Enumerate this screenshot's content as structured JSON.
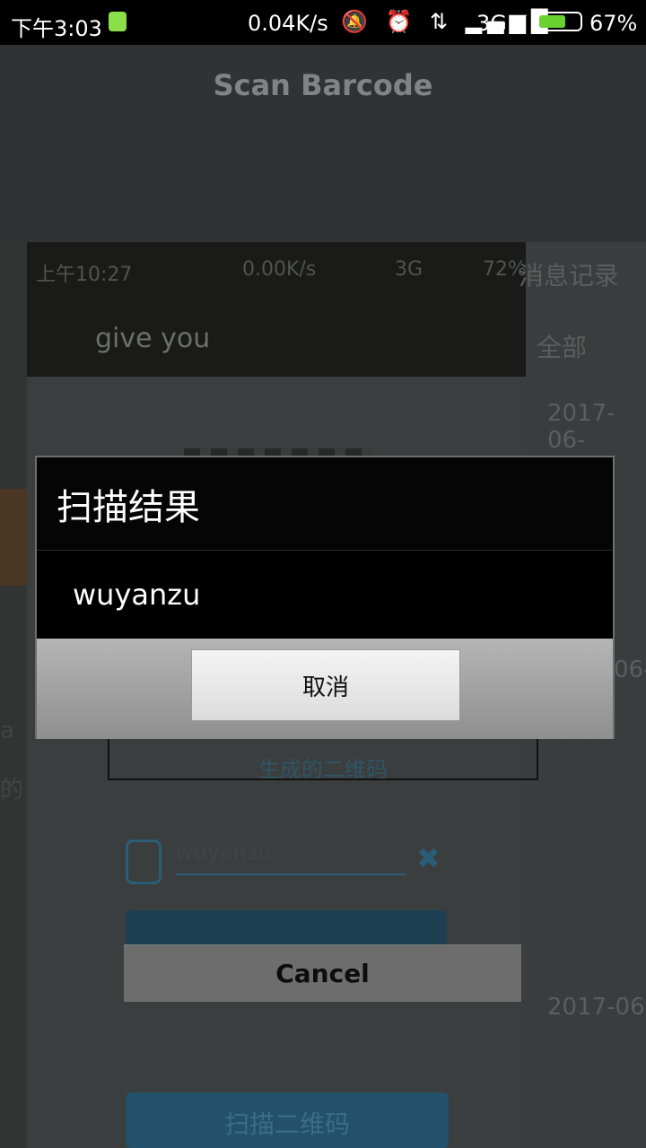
{
  "status_bar": {
    "time": "下午3:03",
    "speed": "0.04K/s",
    "icons": "🔕 ⏰ ⇅ ▂▄▆█",
    "network": "3G ⚡",
    "battery_pct": "67%",
    "battery_level": 0.67,
    "accent": "#6ad22f"
  },
  "scanner": {
    "title": "Scan Barcode",
    "cancel_label": "Cancel"
  },
  "background_photo": {
    "phone_time": "上午10:27",
    "phone_speed": "0.00K/s",
    "phone_net": "3G",
    "phone_battery": "72%",
    "chat_name": "give you",
    "right_title": "消息记录",
    "right_tab": "全部",
    "right_date": "2017-06-",
    "right_date2": "06-",
    "right_date3": "2017-06",
    "qr_caption": "生成的二维码",
    "input_value": "wuyanzu",
    "scan_button": "扫描二维码",
    "left_text_1": "a",
    "left_text_2": "的"
  },
  "dialog": {
    "title": "扫描结果",
    "message": "wuyanzu",
    "button_label": "取消"
  }
}
